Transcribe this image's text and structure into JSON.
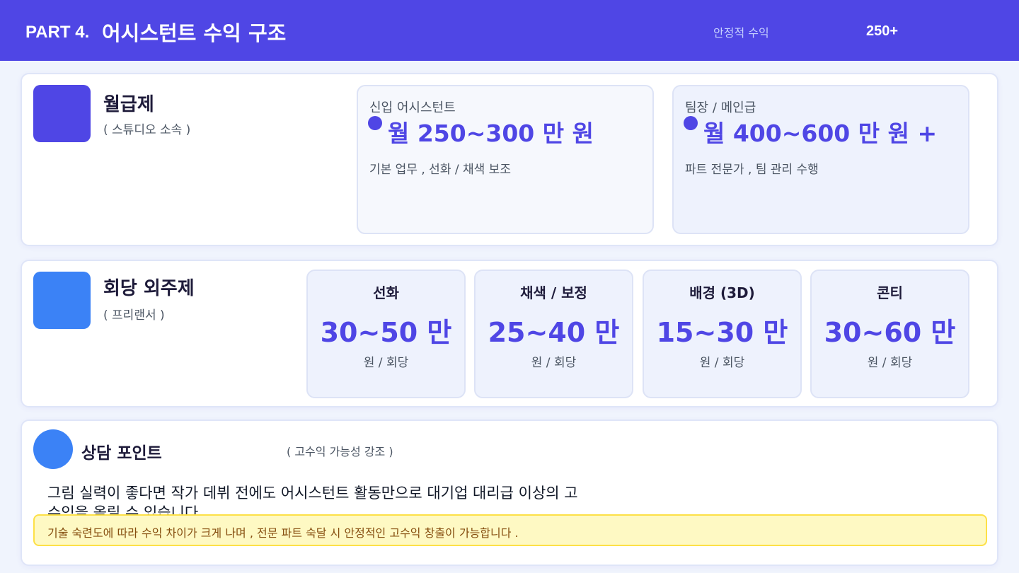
{
  "header": {
    "part_label": "PART 4.",
    "title": "어시스턴트 수익 구조",
    "stat_label": "안정적 수익",
    "stat_value": "250+"
  },
  "salary": {
    "title": "월급제",
    "subtitle": "( 스튜디오 소속 )",
    "tiles": [
      {
        "label": "신입 어시스턴트",
        "amount": "월  250~300 만 원",
        "desc": "기본 업무 ,  선화 / 채색 보조"
      },
      {
        "label": "팀장 / 메인급",
        "amount": "월  400~600 만 원 +",
        "desc": "파트 전문가 ,  팀 관리 수행"
      }
    ]
  },
  "per_episode": {
    "title": "회당 외주제",
    "subtitle": "( 프리랜서 )",
    "tiles": [
      {
        "name": "선화",
        "value": "30~50 만",
        "unit": "원 / 회당"
      },
      {
        "name": "채색 / 보정",
        "value": "25~40 만",
        "unit": "원 / 회당"
      },
      {
        "name": "배경 (3D)",
        "value": "15~30 만",
        "unit": "원 / 회당"
      },
      {
        "name": "콘티",
        "value": "30~60 만",
        "unit": "원 / 회당"
      }
    ]
  },
  "consult": {
    "title": "상담 포인트",
    "note": "( 고수익 가능성 강조 )",
    "body": "그림 실력이 좋다면 작가 데뷔 전에도 어시스턴트 활동만으로 대기업 대리급 이상의 고수익을 올릴 수 있습니다.",
    "highlight": "기술 숙련도에 따라 수익 차이가 크게 나며 ,  전문 파트 숙달 시 안정적인 고수익 창출이 가능합니다 ."
  },
  "colors": {
    "accent": "#4f46e5",
    "blue": "#3b82f6",
    "highlight_bg": "#fef9c3"
  }
}
